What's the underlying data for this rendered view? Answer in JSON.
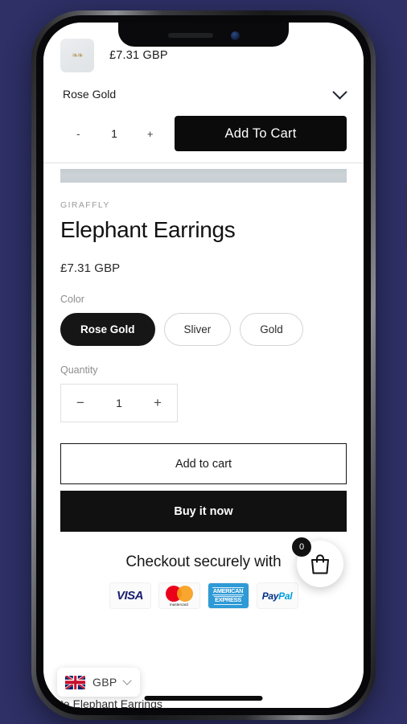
{
  "background_color": "#2e3066",
  "device": {
    "notch": {
      "speaker_icon": "speaker-slot",
      "camera_icon": "front-camera"
    },
    "buttons": [
      "silent-switch",
      "volume-up",
      "volume-down",
      "power"
    ],
    "home_indicator": "home-indicator"
  },
  "sticky_bar": {
    "thumbnail_icon": "product-thumbnail",
    "thumbnail_art": "❧❧",
    "price": "£7.31  GBP",
    "variant_label": "Rose Gold",
    "variant_chevron_icon": "chevron-down-icon",
    "qty_decrement": "-",
    "qty_value": "1",
    "qty_increment": "+",
    "add_to_cart_label": "Add To Cart"
  },
  "product": {
    "vendor": "GIRAFFLY",
    "title": "Elephant Earrings",
    "price": "£7.31 GBP",
    "color_label": "Color",
    "color_options": [
      {
        "label": "Rose Gold",
        "selected": true
      },
      {
        "label": "Sliver",
        "selected": false
      },
      {
        "label": "Gold",
        "selected": false
      }
    ],
    "quantity_label": "Quantity",
    "quantity": {
      "decrement": "−",
      "value": "1",
      "increment": "+"
    },
    "add_to_cart_label": "Add to cart",
    "buy_it_now_label": "Buy it now"
  },
  "trust": {
    "heading": "Checkout securely with",
    "badges": [
      {
        "name": "visa",
        "label": "VISA"
      },
      {
        "name": "mastercard",
        "label": "mastercard"
      },
      {
        "name": "american-express",
        "label_line1": "AMERICAN",
        "label_line2": "EXPRESS"
      },
      {
        "name": "paypal",
        "label_part1": "Pay",
        "label_part2": "Pal"
      }
    ]
  },
  "floating_cart": {
    "icon": "shopping-bag-icon",
    "count": "0"
  },
  "currency_selector": {
    "flag_icon": "uk-flag-icon",
    "code": "GBP",
    "chevron_icon": "chevron-down-icon"
  },
  "clipped_text": "te Elephant Earrings"
}
